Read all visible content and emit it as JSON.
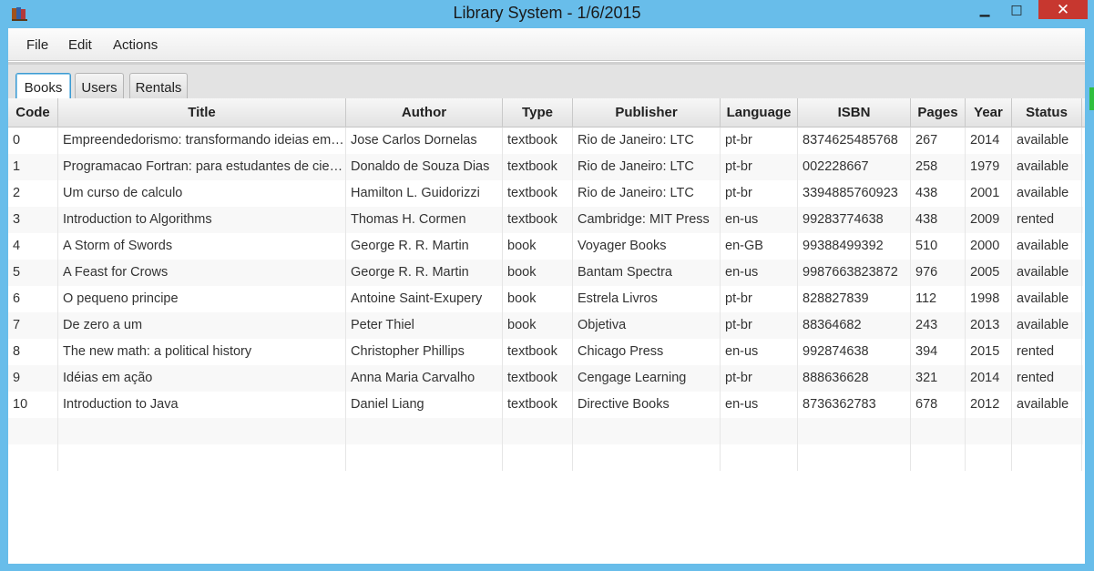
{
  "window": {
    "title": "Library System - 1/6/2015",
    "icon": "books-icon",
    "controls": {
      "minimize": "▁",
      "maximize": "□",
      "close": "✕"
    }
  },
  "menu": {
    "items": [
      "File",
      "Edit",
      "Actions"
    ]
  },
  "tabs": [
    {
      "label": "Books",
      "active": true
    },
    {
      "label": "Users",
      "active": false
    },
    {
      "label": "Rentals",
      "active": false
    }
  ],
  "table": {
    "columns": [
      "Code",
      "Title",
      "Author",
      "Type",
      "Publisher",
      "Language",
      "ISBN",
      "Pages",
      "Year",
      "Status"
    ],
    "rows": [
      [
        "0",
        "Empreendedorismo: transformando ideias em negócios",
        "Jose Carlos Dornelas",
        "textbook",
        "Rio de Janeiro: LTC",
        "pt-br",
        "8374625485768",
        "267",
        "2014",
        "available"
      ],
      [
        "1",
        "Programacao Fortran: para estudantes de ciencias",
        "Donaldo de Souza Dias",
        "textbook",
        "Rio de Janeiro: LTC",
        "pt-br",
        "002228667",
        "258",
        "1979",
        "available"
      ],
      [
        "2",
        "Um curso de calculo",
        "Hamilton L. Guidorizzi",
        "textbook",
        "Rio de Janeiro: LTC",
        "pt-br",
        "3394885760923",
        "438",
        "2001",
        "available"
      ],
      [
        "3",
        "Introduction to Algorithms",
        "Thomas H. Cormen",
        "textbook",
        "Cambridge: MIT Press",
        "en-us",
        "99283774638",
        "438",
        "2009",
        "rented"
      ],
      [
        "4",
        "A Storm of Swords",
        "George R. R. Martin",
        "book",
        "Voyager Books",
        "en-GB",
        "99388499392",
        "510",
        "2000",
        "available"
      ],
      [
        "5",
        "A Feast for Crows",
        "George R. R. Martin",
        "book",
        "Bantam Spectra",
        "en-us",
        "9987663823872",
        "976",
        "2005",
        "available"
      ],
      [
        "6",
        "O pequeno principe",
        "Antoine Saint-Exupery",
        "book",
        "Estrela Livros",
        "pt-br",
        "828827839",
        "112",
        "1998",
        "available"
      ],
      [
        "7",
        "De zero a um",
        "Peter Thiel",
        "book",
        "Objetiva",
        "pt-br",
        "88364682",
        "243",
        "2013",
        "available"
      ],
      [
        "8",
        "The new math: a political history",
        "Christopher Phillips",
        "textbook",
        "Chicago Press",
        "en-us",
        "992874638",
        "394",
        "2015",
        "rented"
      ],
      [
        "9",
        "Idéias em ação",
        "Anna Maria Carvalho",
        "textbook",
        "Cengage Learning",
        "pt-br",
        "888636628",
        "321",
        "2014",
        "rented"
      ],
      [
        "10",
        "Introduction to Java",
        "Daniel Liang",
        "textbook",
        "Directive Books",
        "en-us",
        "8736362783",
        "678",
        "2012",
        "available"
      ]
    ]
  }
}
